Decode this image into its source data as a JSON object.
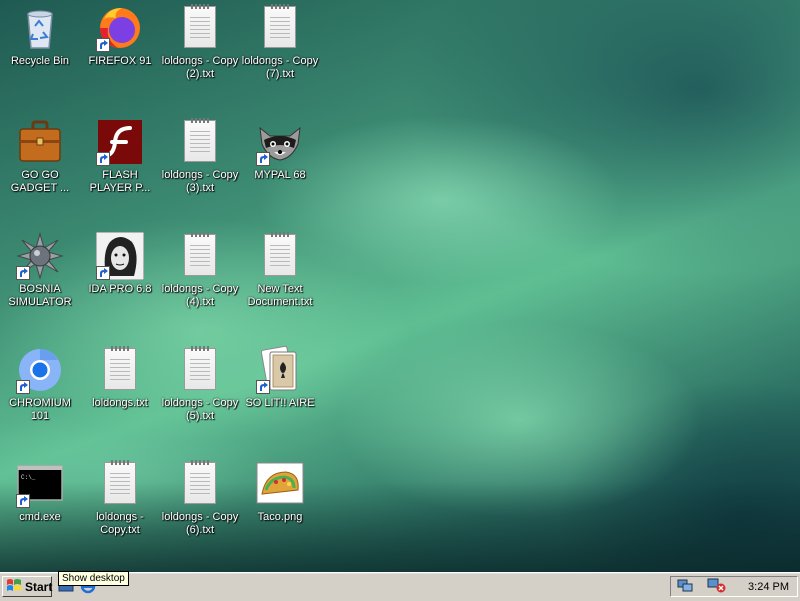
{
  "desktop": {
    "icons": [
      {
        "id": "recycle-bin",
        "label": "Recycle Bin"
      },
      {
        "id": "firefox",
        "label": "FIREFOX 91"
      },
      {
        "id": "copy2",
        "label": "loldongs - Copy\n(2).txt"
      },
      {
        "id": "copy7",
        "label": "loldongs - Copy\n(7).txt"
      },
      {
        "id": "gogo",
        "label": "GO GO\nGADGET ..."
      },
      {
        "id": "flash",
        "label": "FLASH\nPLAYER P..."
      },
      {
        "id": "copy3",
        "label": "loldongs - Copy\n(3).txt"
      },
      {
        "id": "mypal",
        "label": "MYPAL 68"
      },
      {
        "id": "bosnia",
        "label": "BOSNIA\nSIMULATOR"
      },
      {
        "id": "ida",
        "label": "IDA PRO 6.8"
      },
      {
        "id": "copy4",
        "label": "loldongs - Copy\n(4).txt"
      },
      {
        "id": "newtext",
        "label": "New Text\nDocument.txt"
      },
      {
        "id": "chromium",
        "label": "CHROMIUM\n101"
      },
      {
        "id": "loldongs",
        "label": "loldongs.txt"
      },
      {
        "id": "copy5",
        "label": "loldongs - Copy\n(5).txt"
      },
      {
        "id": "solitaire",
        "label": "SO LIT!! AIRE"
      },
      {
        "id": "cmd",
        "label": "cmd.exe"
      },
      {
        "id": "loldongscopy",
        "label": "loldongs -\nCopy.txt"
      },
      {
        "id": "copy6",
        "label": "loldongs - Copy\n(6).txt"
      },
      {
        "id": "taco",
        "label": "Taco.png"
      }
    ]
  },
  "taskbar": {
    "start_label": "Start",
    "tooltip": "Show desktop",
    "clock": "3:24 PM"
  }
}
